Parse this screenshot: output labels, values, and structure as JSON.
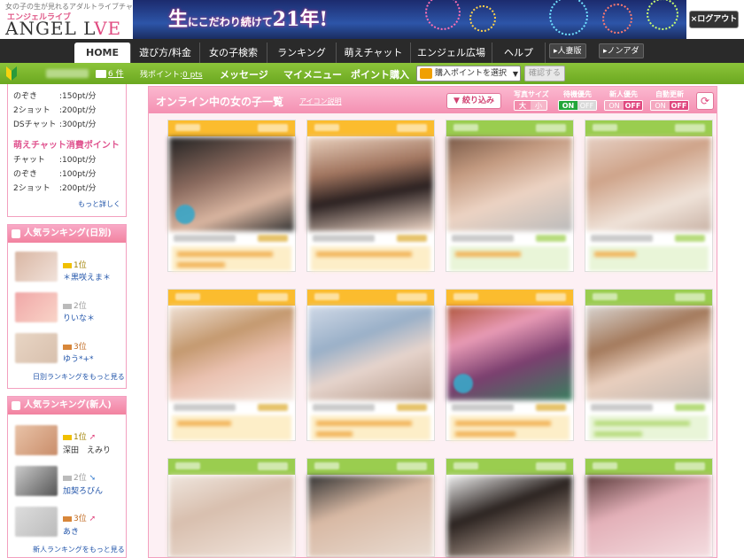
{
  "header": {
    "tagline": "女の子の生が見れるアダルトライブチャット",
    "logo_sub": "エンジェルライブ",
    "logo_main": "ANGEL L",
    "logo_accent": "VE",
    "banner_text_a": "生",
    "banner_text_b": "にこだわり続けて",
    "banner_text_c": "21年!",
    "logout_label": "×ログアウト"
  },
  "nav": {
    "tabs": [
      "HOME",
      "遊び方/料金",
      "女の子検索",
      "ランキング",
      "萌えチャット",
      "エンジェル広場",
      "ヘルプ"
    ],
    "extra": [
      "▸人妻版",
      "▸ノンアダ"
    ]
  },
  "userbar": {
    "mail_count": "6 件",
    "points_label": "残ポイント:",
    "points_value": "0 pts",
    "links": [
      "メッセージ",
      "マイメニュー",
      "ポイント購入"
    ],
    "select_value": "購入ポイントを選択",
    "confirm_label": "確認する"
  },
  "pricing": {
    "rows_top": [
      {
        "label": "のぞき",
        "value": ":150pt/分"
      },
      {
        "label": "2ショット",
        "value": ":200pt/分"
      },
      {
        "label": "DSチャット",
        "value": ":300pt/分"
      }
    ],
    "moe_title": "萌えチャット消費ポイント",
    "rows_moe": [
      {
        "label": "チャット",
        "value": ":100pt/分"
      },
      {
        "label": "のぞき",
        "value": ":100pt/分"
      },
      {
        "label": "2ショット",
        "value": ":200pt/分"
      }
    ],
    "more_label": "もっと詳しく"
  },
  "ranking_daily": {
    "title": "人気ランキング(日別)",
    "items": [
      {
        "rank": "1位",
        "name": "＊黒咲えま＊"
      },
      {
        "rank": "2位",
        "name": "りいな＊"
      },
      {
        "rank": "3位",
        "name": "ゆう*+*"
      }
    ],
    "more_label": "日別ランキングをもっと見る"
  },
  "ranking_new": {
    "title": "人気ランキング(新人)",
    "items": [
      {
        "rank": "1位",
        "name": "深田　えみり",
        "trend": "➚"
      },
      {
        "rank": "2位",
        "name": "加契ろびん",
        "trend": "➘"
      },
      {
        "rank": "3位",
        "name": "あき",
        "trend": "➚"
      }
    ],
    "more_label": "新人ランキングをもっと見る"
  },
  "main": {
    "title": "オンライン中の女の子一覧",
    "icon_help": "アイコン説明",
    "filter_label": "絞り込み",
    "toggles": [
      {
        "label": "写真サイズ",
        "a": "大",
        "b": "小"
      },
      {
        "label": "待機優先",
        "a": "ON",
        "b": "OFF"
      },
      {
        "label": "新人優先",
        "a": "ON",
        "b": "OFF"
      },
      {
        "label": "自動更新",
        "a": "ON",
        "b": "OFF"
      }
    ],
    "refresh_icon": "⟳"
  },
  "colors": {
    "pink": "#f490b2",
    "green": "#8cc43a",
    "orange": "#fbbc2e"
  }
}
